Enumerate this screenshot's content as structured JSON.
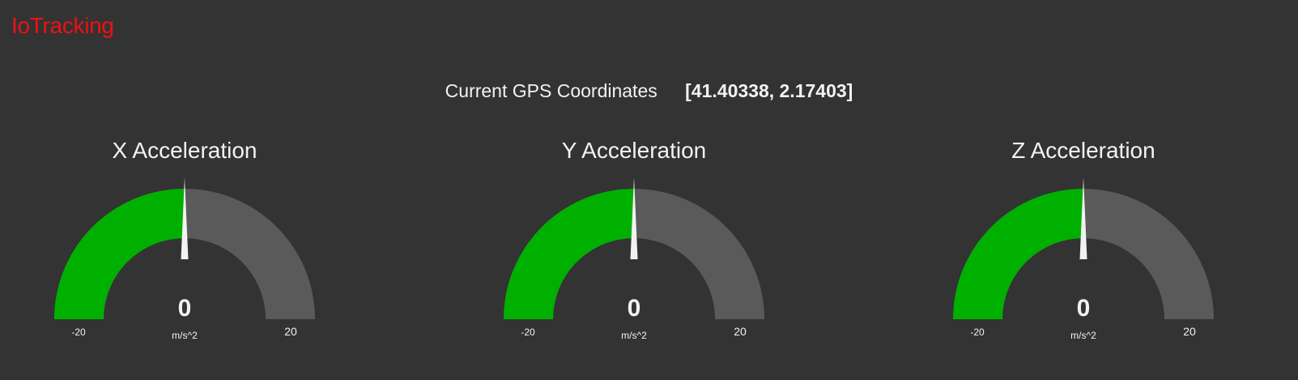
{
  "app": {
    "title": "IoTracking",
    "brand_color": "#ee1111",
    "background": "#333333"
  },
  "gps": {
    "label": "Current GPS Coordinates",
    "value": "[41.40338, 2.17403]"
  },
  "gauges": [
    {
      "title": "X Acceleration",
      "value": "0",
      "unit": "m/s^2",
      "min": "-20",
      "max": "20",
      "level": 0.5
    },
    {
      "title": "Y Acceleration",
      "value": "0",
      "unit": "m/s^2",
      "min": "-20",
      "max": "20",
      "level": 0.5
    },
    {
      "title": "Z Acceleration",
      "value": "0",
      "unit": "m/s^2",
      "min": "-20",
      "max": "20",
      "level": 0.5
    }
  ],
  "colors": {
    "gauge_fill": "#00b000",
    "gauge_track": "#5a5a5a",
    "needle": "#f2f2f2"
  }
}
